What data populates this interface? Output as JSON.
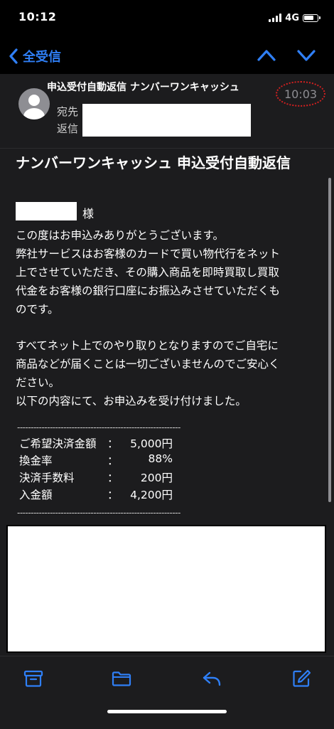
{
  "status": {
    "time": "10:12",
    "network": "4G"
  },
  "nav": {
    "back_label": "全受信"
  },
  "header": {
    "sender": "申込受付自動返信 ナンバーワンキャッシュ",
    "time": "10:03",
    "to_label": "宛先",
    "reply_label": "返信"
  },
  "body": {
    "subject": "ナンバーワンキャッシュ 申込受付自動返信",
    "honorific": "様",
    "para1_lines": [
      "この度はお申込みありがとうございます。",
      "弊社サービスはお客様のカードで買い物代行をネット",
      "上でさせていただき、その購入商品を即時買取し買取",
      "代金をお客様の銀行口座にお振込みさせていただくも",
      "のです。"
    ],
    "para2_lines": [
      "すべてネット上でのやり取りとなりますのでご自宅に",
      "商品などが届くことは一切ございませんのでご安心く",
      "ださい。",
      "以下の内容にて、お申込みを受け付けました。"
    ],
    "divider": "------------------------------------------------------------",
    "rows": [
      {
        "label": "ご希望決済金額",
        "colon": "：",
        "value": "5,000円"
      },
      {
        "label": "換金率",
        "colon": "：",
        "value": "88%"
      },
      {
        "label": "決済手数料",
        "colon": "：",
        "value": "200円"
      },
      {
        "label": "入金額",
        "colon": "：",
        "value": "4,200円"
      }
    ]
  },
  "icons": {
    "back": "chevron-left-icon",
    "prev": "chevron-up-icon",
    "next": "chevron-down-icon",
    "archive": "archive-icon",
    "folder": "folder-icon",
    "reply": "reply-icon",
    "compose": "compose-icon"
  },
  "colors": {
    "accent": "#2f7ff6",
    "highlight_ring": "#d62020",
    "background": "#1c1c1e"
  }
}
